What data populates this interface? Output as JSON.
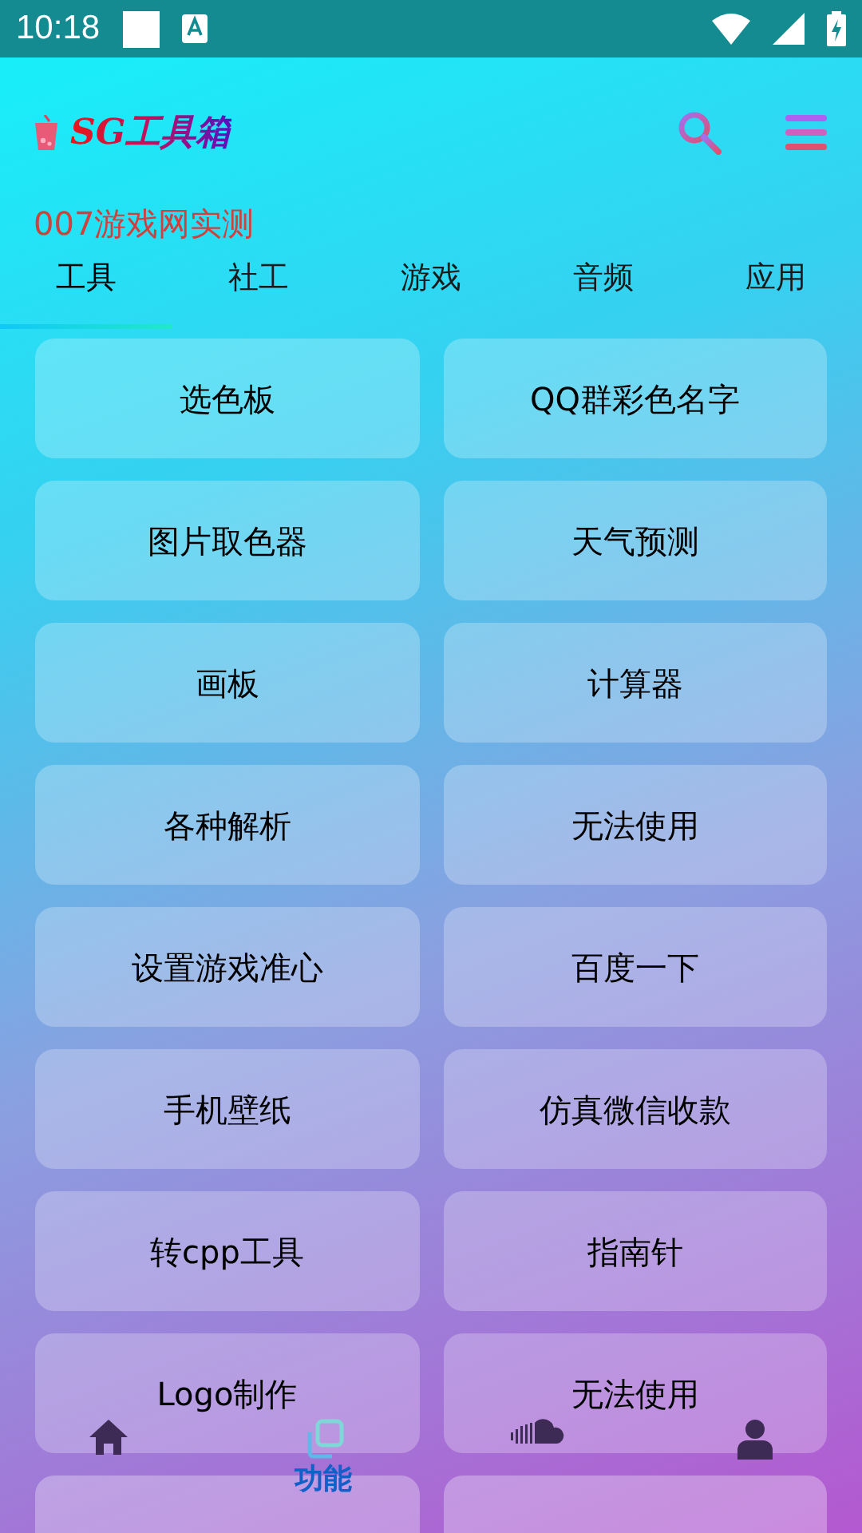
{
  "status_bar": {
    "time": "10:18"
  },
  "app_bar": {
    "title": "SG工具箱"
  },
  "subtitle": "007游戏网实测",
  "tabs": [
    {
      "label": "工具",
      "selected": true
    },
    {
      "label": "社工",
      "selected": false
    },
    {
      "label": "游戏",
      "selected": false
    },
    {
      "label": "音频",
      "selected": false
    },
    {
      "label": "应用",
      "selected": false
    }
  ],
  "tools": [
    {
      "label": "选色板"
    },
    {
      "label": "QQ群彩色名字"
    },
    {
      "label": "图片取色器"
    },
    {
      "label": "天气预测"
    },
    {
      "label": "画板"
    },
    {
      "label": "计算器"
    },
    {
      "label": "各种解析"
    },
    {
      "label": "无法使用"
    },
    {
      "label": "设置游戏准心"
    },
    {
      "label": "百度一下"
    },
    {
      "label": "手机壁纸"
    },
    {
      "label": "仿真微信收款"
    },
    {
      "label": "转cpp工具"
    },
    {
      "label": "指南针"
    },
    {
      "label": "Logo制作"
    },
    {
      "label": "无法使用"
    },
    {
      "kind": "cut_off"
    },
    {
      "kind": "cut_off"
    }
  ],
  "bottom_nav": [
    {
      "kind": "home",
      "selected": false
    },
    {
      "kind": "feature",
      "label": "功能",
      "selected": true
    },
    {
      "kind": "audio",
      "selected": false
    },
    {
      "kind": "profile",
      "selected": false
    }
  ]
}
